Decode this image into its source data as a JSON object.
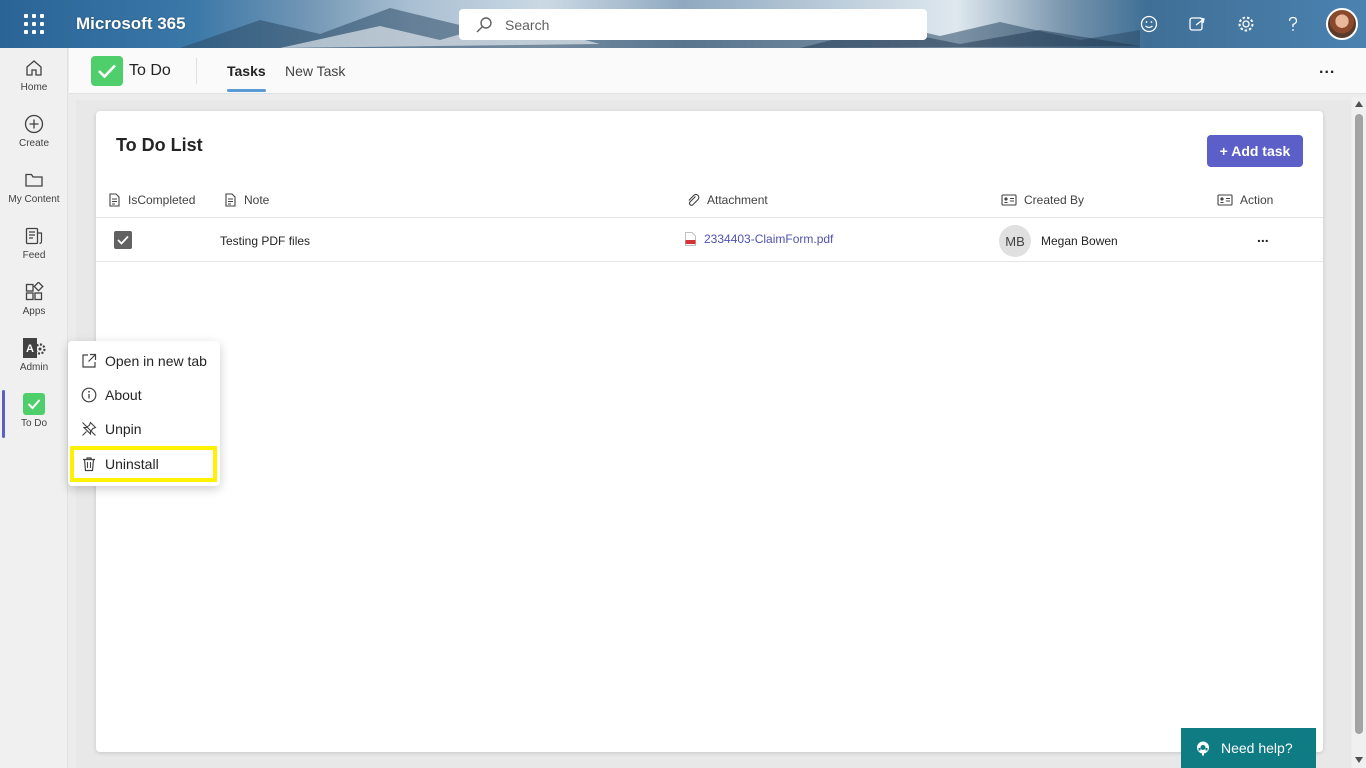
{
  "topbar": {
    "brand": "Microsoft 365",
    "search_placeholder": "Search",
    "icons": [
      "waffle-icon",
      "search-icon",
      "feedback-icon",
      "share-icon",
      "settings-icon",
      "help-icon"
    ]
  },
  "rail": {
    "items": [
      {
        "label": "Home",
        "icon": "home-icon"
      },
      {
        "label": "Create",
        "icon": "plus-circle-icon"
      },
      {
        "label": "My Content",
        "icon": "folder-icon"
      },
      {
        "label": "Feed",
        "icon": "feed-icon"
      },
      {
        "label": "Apps",
        "icon": "apps-icon"
      },
      {
        "label": "Admin",
        "icon": "admin-icon"
      },
      {
        "label": "To Do",
        "icon": "todo-check-icon"
      }
    ]
  },
  "app_header": {
    "name": "To Do",
    "tabs": [
      {
        "label": "Tasks",
        "active": true
      },
      {
        "label": "New Task",
        "active": false
      }
    ],
    "more": "..."
  },
  "card": {
    "title": "To Do List",
    "add_button": "+ Add task",
    "columns": [
      "IsCompleted",
      "Note",
      "Attachment",
      "Created By",
      "Action"
    ],
    "rows": [
      {
        "is_completed": true,
        "note": "Testing PDF files",
        "attachment": "2334403-ClaimForm.pdf",
        "creator_initials": "MB",
        "created_by": "Megan Bowen",
        "action": "..."
      }
    ]
  },
  "context_menu": {
    "items": [
      {
        "label": "Open in new tab",
        "icon": "open-new-tab-icon"
      },
      {
        "label": "About",
        "icon": "info-icon"
      },
      {
        "label": "Unpin",
        "icon": "unpin-icon"
      },
      {
        "label": "Uninstall",
        "icon": "trash-icon",
        "highlight_color": "#fff200"
      }
    ]
  },
  "help": {
    "label": "Need help?"
  },
  "colors": {
    "accent": "#5b5fc7",
    "todo_green": "#4ecf6b",
    "help_teal": "#0f7b83",
    "highlight": "#fff200"
  }
}
